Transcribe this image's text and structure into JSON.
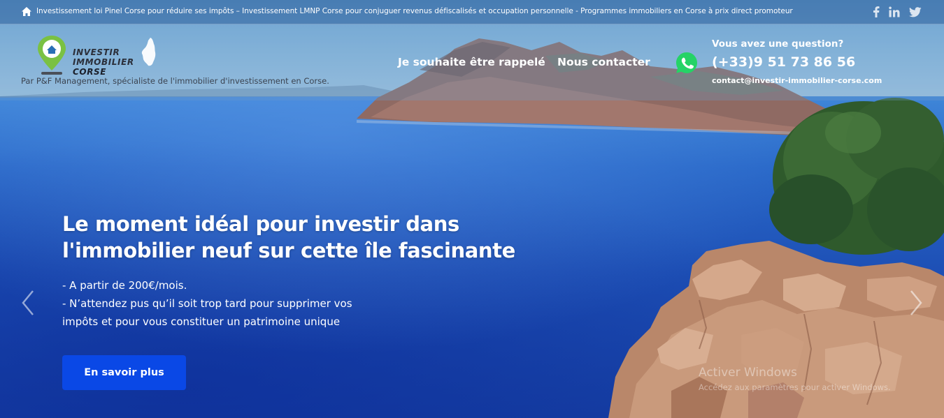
{
  "topbar": {
    "text": "Investissement loi Pinel Corse pour réduire ses impôts – Investissement LMNP Corse pour conjuguer revenus défiscalisés et occupation personnelle - Programmes immobiliers en Corse à prix direct promoteur",
    "social": [
      "facebook-icon",
      "linkedin-icon",
      "twitter-icon"
    ]
  },
  "logo": {
    "line1": "INVESTIR",
    "line2": "IMMOBILIER",
    "line3": "CORSE"
  },
  "header": {
    "tagline": "Par P&F Management, spécialiste de l'immobilier d'investissement en Corse.",
    "nav": {
      "callback": "Je souhaite être rappelé",
      "contact": "Nous contacter"
    },
    "question": "Vous avez une question?",
    "phone": "(+33)9 51 73 86 56",
    "email": "contact@investir-immobilier-corse.com"
  },
  "hero": {
    "title_line1": "Le moment idéal pour investir dans",
    "title_line2": "l'immobilier neuf sur cette île fascinante",
    "bullet1": "- A partir de 200€/mois.",
    "bullet2": "- N’attendez pus qu’il soit trop tard pour supprimer vos",
    "bullet3": "impôts et pour vous constituer un patrimoine unique",
    "cta": "En savoir plus"
  },
  "watermark": {
    "line1": "Activer Windows",
    "line2": "Accédez aux paramètres pour activer Windows."
  },
  "colors": {
    "cta": "#0a48e6",
    "whatsapp": "#25d366",
    "sea": "#1d4fb5"
  }
}
